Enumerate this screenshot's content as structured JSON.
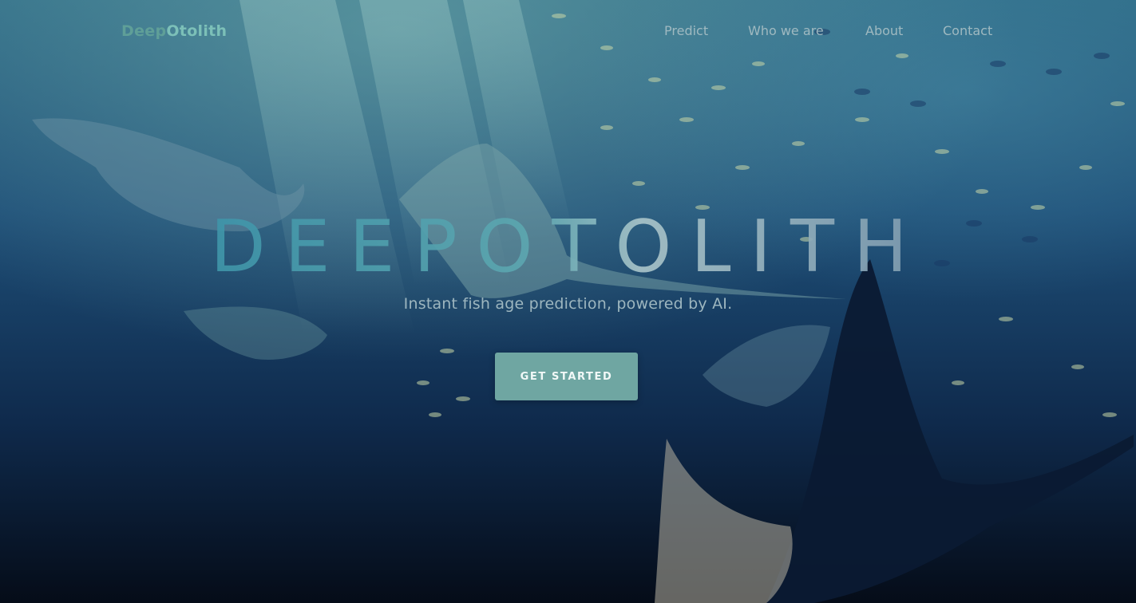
{
  "nav": {
    "brand_part1": "Deep",
    "brand_part2": "Otolith",
    "links": [
      "Predict",
      "Who we are",
      "About",
      "Contact"
    ]
  },
  "hero": {
    "title": "DEEPOTOLITH",
    "subtitle": "Instant fish age prediction, powered by AI.",
    "cta_label": "GET STARTED"
  },
  "colors": {
    "brand": "#5f9f98",
    "cta_background": "#6fa6a2",
    "nav_link": "#9fb9c0",
    "ocean_top": "#2f6e8a",
    "ocean_bottom": "#06101e"
  }
}
